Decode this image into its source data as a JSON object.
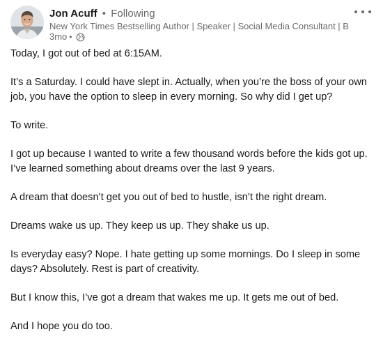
{
  "post": {
    "author": {
      "name": "Jon Acuff",
      "separator": "•",
      "follow_status": "Following",
      "headline": "New York Times Bestselling Author | Speaker | Social Media Consultant | Br...",
      "time_ago": "3mo",
      "meta_separator": "•",
      "visibility_icon": "globe-icon",
      "avatar_icon": "profile-photo"
    },
    "menu_icon": "more-horizontal-icon",
    "paragraphs": [
      "Today, I got out of bed at 6:15AM.",
      "It’s a Saturday. I could have slept in. Actually, when you’re the boss of your own job, you have the option to sleep in every morning. So why did I get up?",
      "To write.",
      "I got up because I wanted to write a few thousand words before the kids got up. I’ve learned something about dreams over the last 9 years.",
      "A dream that doesn’t get you out of bed to hustle, isn’t the right dream.",
      "Dreams wake us up. They keep us up. They shake us up.",
      "Is everyday easy? Nope. I hate getting up some mornings. Do I sleep in some days? Absolutely. Rest is part of creativity.",
      "But I know this, I’ve got a dream that wakes me up. It gets me out of bed.",
      "And I hope you do too."
    ]
  },
  "colors": {
    "primary_text": "#191919",
    "secondary_text": "#666666",
    "background": "#ffffff"
  }
}
